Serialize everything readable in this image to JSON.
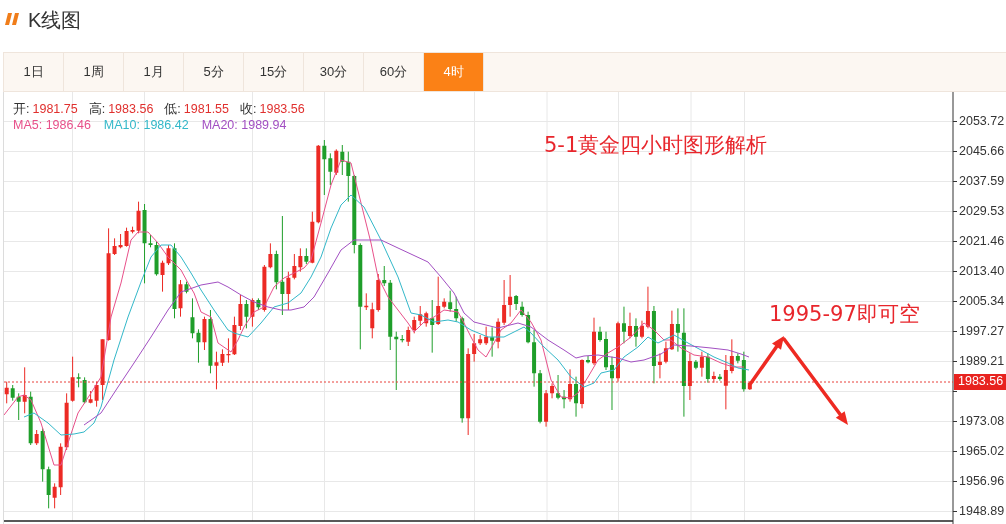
{
  "header": {
    "title": "K线图"
  },
  "tabs": [
    {
      "label": "1日",
      "selected": false
    },
    {
      "label": "1周",
      "selected": false
    },
    {
      "label": "1月",
      "selected": false
    },
    {
      "label": "5分",
      "selected": false
    },
    {
      "label": "15分",
      "selected": false
    },
    {
      "label": "30分",
      "selected": false
    },
    {
      "label": "60分",
      "selected": false
    },
    {
      "label": "4时",
      "selected": true
    }
  ],
  "quote": [
    {
      "label": "开:",
      "value": "1981.75"
    },
    {
      "label": "高:",
      "value": "1983.56"
    },
    {
      "label": "低:",
      "value": "1981.55"
    },
    {
      "label": "收:",
      "value": "1983.56"
    }
  ],
  "moving_averages": [
    {
      "text": "MA5: 1986.46",
      "color": "#e8508a"
    },
    {
      "text": "MA10: 1986.42",
      "color": "#33b8c9"
    },
    {
      "text": "MA20: 1989.94",
      "color": "#a24fc2"
    }
  ],
  "chart": {
    "price_axis": {
      "upper_labels": [
        "2053.72",
        "2045.66",
        "2037.59",
        "2029.53",
        "2021.46",
        "2013.40",
        "2005.34",
        "1997.27",
        "1989.21"
      ],
      "lower_labels": [
        "1973.08",
        "1965.02",
        "1956.96",
        "1948.89"
      ]
    },
    "last_price": "1983.56",
    "annotations": [
      "5-1黄金四小时图形解析",
      "1995-97即可空"
    ]
  }
}
